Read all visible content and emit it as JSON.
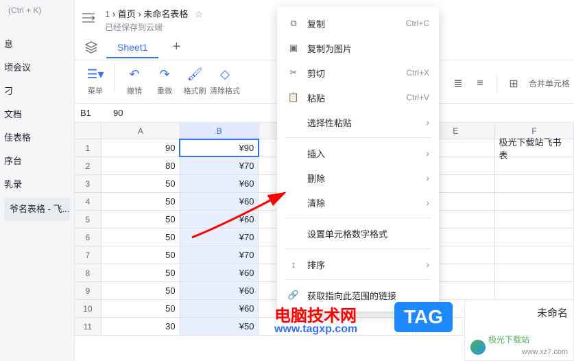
{
  "ctrl_k": "(Ctrl + K)",
  "sidebar": {
    "items": [
      "息",
      "顷会议",
      "刁",
      "文档",
      "佳表格",
      "序台",
      "乳录",
      "爷名表格 - 飞..."
    ]
  },
  "breadcrumb": {
    "num": "1",
    "home": "首页",
    "doc": "未命名表格",
    "saved": "已经保存到云端"
  },
  "tabs": {
    "active": "Sheet1"
  },
  "toolbar": {
    "menu": "菜单",
    "undo": "撤销",
    "redo": "重做",
    "format_painter": "格式刷",
    "clear_format": "清除格式",
    "merge": "合并单元格"
  },
  "cellref": {
    "ref": "B1",
    "val": "90"
  },
  "columns": [
    "A",
    "B",
    "",
    "",
    "E",
    "F"
  ],
  "rows": [
    {
      "n": "1",
      "a": "90",
      "b": "¥90"
    },
    {
      "n": "2",
      "a": "80",
      "b": "¥70"
    },
    {
      "n": "3",
      "a": "50",
      "b": "¥60"
    },
    {
      "n": "4",
      "a": "50",
      "b": "¥60"
    },
    {
      "n": "5",
      "a": "50",
      "b": "¥60"
    },
    {
      "n": "6",
      "a": "50",
      "b": "¥70"
    },
    {
      "n": "7",
      "a": "50",
      "b": "¥70"
    },
    {
      "n": "8",
      "a": "50",
      "b": "¥60"
    },
    {
      "n": "9",
      "a": "50",
      "b": "¥60"
    },
    {
      "n": "10",
      "a": "50",
      "b": "¥60"
    },
    {
      "n": "11",
      "a": "30",
      "b": "¥50"
    }
  ],
  "f1_text": "极光下载站飞书表",
  "ctx": {
    "copy": "复制",
    "copy_sc": "Ctrl+C",
    "copy_img": "复制为图片",
    "cut": "剪切",
    "cut_sc": "Ctrl+X",
    "paste": "粘贴",
    "paste_sc": "Ctrl+V",
    "paste_special": "选择性粘贴",
    "insert": "插入",
    "delete": "删除",
    "clear": "清除",
    "number_format": "设置单元格数字格式",
    "sort": "排序",
    "get_link": "获取指向此范围的链接"
  },
  "watermark": {
    "line1": "电脑技术网",
    "line2": "www.tagxp.com"
  },
  "tag_badge": "TAG",
  "right_box": {
    "title": "未命名",
    "logo_text": "极光下载站",
    "url": "www.xz7.com"
  }
}
